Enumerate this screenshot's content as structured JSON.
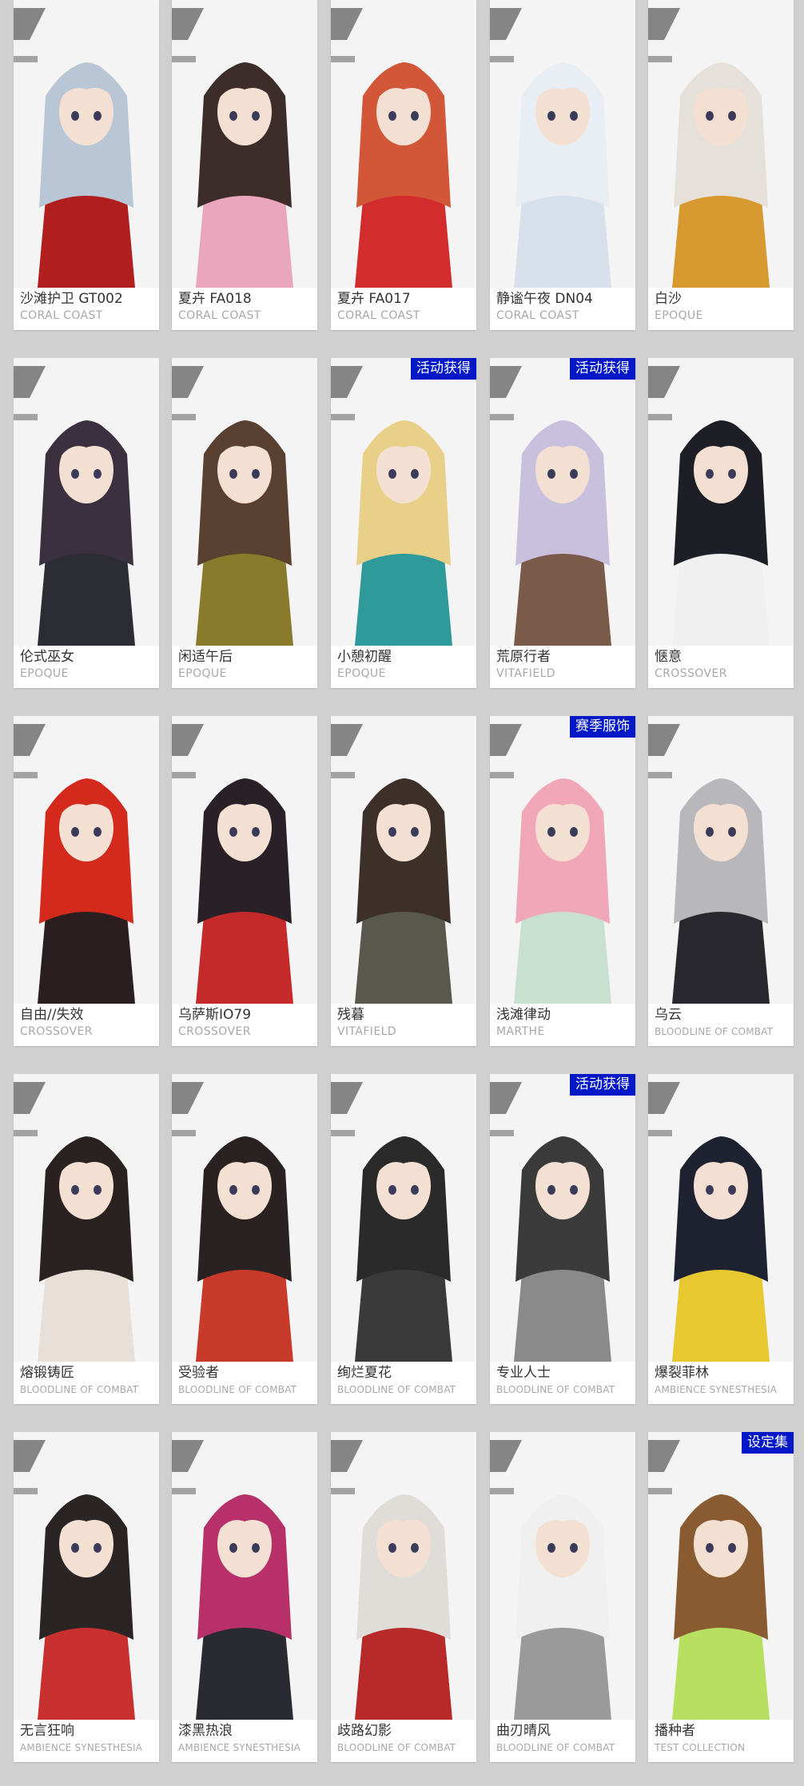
{
  "colors": {
    "page_background": "#d0d0d0",
    "card_background": "#ffffff",
    "badge_background": "#0018c8",
    "badge_text": "#ffffff",
    "name_text": "#333333",
    "series_text": "#a8a8a8"
  },
  "skins": [
    {
      "name": "沙滩护卫 GT002",
      "series": "CORAL COAST",
      "badge": null,
      "hair": "#b8c6d6",
      "accent": "#b01e1e"
    },
    {
      "name": "夏卉 FA018",
      "series": "CORAL COAST",
      "badge": null,
      "hair": "#3c2c2a",
      "accent": "#e9a6bc"
    },
    {
      "name": "夏卉 FA017",
      "series": "CORAL COAST",
      "badge": null,
      "hair": "#d25638",
      "accent": "#d22c2c"
    },
    {
      "name": "静谧午夜 DN04",
      "series": "CORAL COAST",
      "badge": null,
      "hair": "#e8eef4",
      "accent": "#d8e0ec"
    },
    {
      "name": "白沙",
      "series": "EPOQUE",
      "badge": null,
      "hair": "#e6e0da",
      "accent": "#d89a30"
    },
    {
      "name": "伦式巫女",
      "series": "EPOQUE",
      "badge": null,
      "hair": "#3a3040",
      "accent": "#2c2c34"
    },
    {
      "name": "闲适午后",
      "series": "EPOQUE",
      "badge": null,
      "hair": "#5a4030",
      "accent": "#8a7a2c"
    },
    {
      "name": "小憩初醒",
      "series": "EPOQUE",
      "badge": "活动获得",
      "hair": "#e8d088",
      "accent": "#2e9a9a"
    },
    {
      "name": "荒原行者",
      "series": "VITAFIELD",
      "badge": "活动获得",
      "hair": "#c8c0dc",
      "accent": "#7a5a48"
    },
    {
      "name": "惬意",
      "series": "CROSSOVER",
      "badge": null,
      "hair": "#1e1e26",
      "accent": "#f0f0f0"
    },
    {
      "name": "自由//失效",
      "series": "CROSSOVER",
      "badge": null,
      "hair": "#d42a1e",
      "accent": "#2a1e20"
    },
    {
      "name": "乌萨斯IO79",
      "series": "CROSSOVER",
      "badge": null,
      "hair": "#2a2028",
      "accent": "#c42a2a"
    },
    {
      "name": "残暮",
      "series": "VITAFIELD",
      "badge": null,
      "hair": "#3c3028",
      "accent": "#58584c"
    },
    {
      "name": "浅滩律动",
      "series": "MARTHE",
      "badge": "赛季服饰",
      "hair": "#f0a8b8",
      "accent": "#c8e0d0"
    },
    {
      "name": "乌云",
      "series": "BLOODLINE OF COMBAT",
      "badge": null,
      "hair": "#b8b8bc",
      "accent": "#28282e"
    },
    {
      "name": "熔锻铸匠",
      "series": "BLOODLINE OF COMBAT",
      "badge": null,
      "hair": "#2a2220",
      "accent": "#e8e0d8"
    },
    {
      "name": "受验者",
      "series": "BLOODLINE OF COMBAT",
      "badge": null,
      "hair": "#2a2222",
      "accent": "#c83a2a"
    },
    {
      "name": "绚烂夏花",
      "series": "BLOODLINE OF COMBAT",
      "badge": null,
      "hair": "#2a2a2a",
      "accent": "#3a3a3a"
    },
    {
      "name": "专业人士",
      "series": "BLOODLINE OF COMBAT",
      "badge": "活动获得",
      "hair": "#3a3a3a",
      "accent": "#8a8a8a"
    },
    {
      "name": "爆裂菲林",
      "series": "AMBIENCE SYNESTHESIA",
      "badge": null,
      "hair": "#1e2230",
      "accent": "#e8c830"
    },
    {
      "name": "无言狂响",
      "series": "AMBIENCE SYNESTHESIA",
      "badge": null,
      "hair": "#2a2424",
      "accent": "#c83030"
    },
    {
      "name": "漆黑热浪",
      "series": "AMBIENCE SYNESTHESIA",
      "badge": null,
      "hair": "#b8306a",
      "accent": "#2a2a32"
    },
    {
      "name": "歧路幻影",
      "series": "BLOODLINE OF COMBAT",
      "badge": null,
      "hair": "#e0dcd8",
      "accent": "#b82a2a"
    },
    {
      "name": "曲刃晴风",
      "series": "BLOODLINE OF COMBAT",
      "badge": null,
      "hair": "#f0f0f0",
      "accent": "#9a9a9a"
    },
    {
      "name": "播种者",
      "series": "TEST COLLECTION",
      "badge": "设定集",
      "hair": "#8a5a30",
      "accent": "#b8e060"
    }
  ]
}
